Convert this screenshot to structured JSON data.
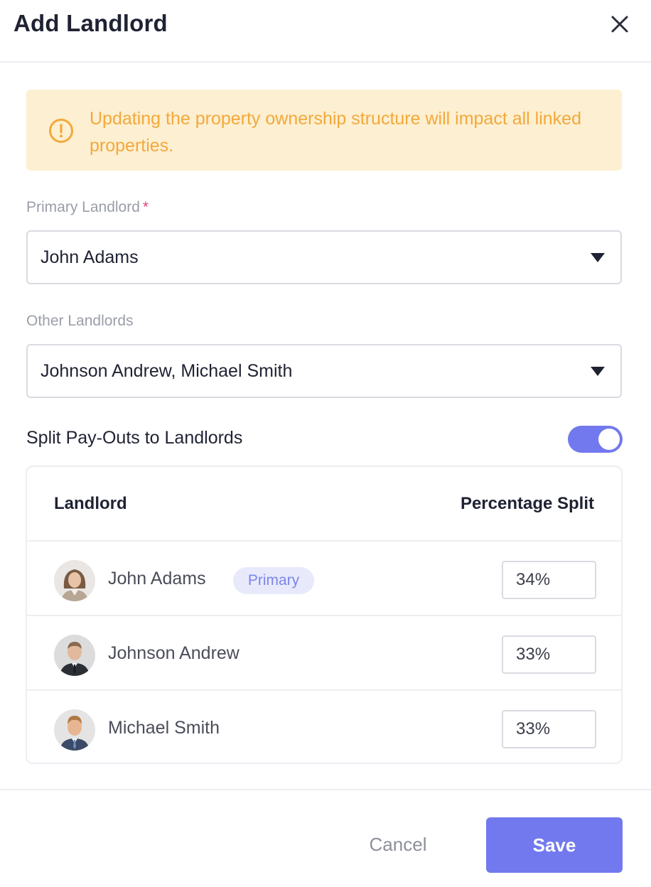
{
  "dialog": {
    "title": "Add Landlord",
    "close_icon": "close-icon"
  },
  "alert": {
    "icon": "warning-circle-icon",
    "text": "Updating the property ownership structure will impact all linked properties.",
    "color": "#f2a93b",
    "background": "#fdefd1"
  },
  "primary_landlord": {
    "label": "Primary Landlord",
    "required_mark": "*",
    "value": "John Adams"
  },
  "other_landlords": {
    "label": "Other Landlords",
    "value": "Johnson Andrew, Michael Smith"
  },
  "split_payouts": {
    "label": "Split Pay-Outs to Landlords",
    "enabled": true
  },
  "table": {
    "headers": [
      "Landlord",
      "Percentage Split"
    ],
    "rows": [
      {
        "name": "John Adams",
        "badge": "Primary",
        "percentage": "34%",
        "avatar": "avatar-woman-icon"
      },
      {
        "name": "Johnson Andrew",
        "badge": "",
        "percentage": "33%",
        "avatar": "avatar-man-icon"
      },
      {
        "name": "Michael Smith",
        "badge": "",
        "percentage": "33%",
        "avatar": "avatar-man-icon"
      }
    ]
  },
  "footer": {
    "cancel_label": "Cancel",
    "save_label": "Save"
  },
  "colors": {
    "accent": "#7279ee",
    "required": "#e0457b"
  }
}
